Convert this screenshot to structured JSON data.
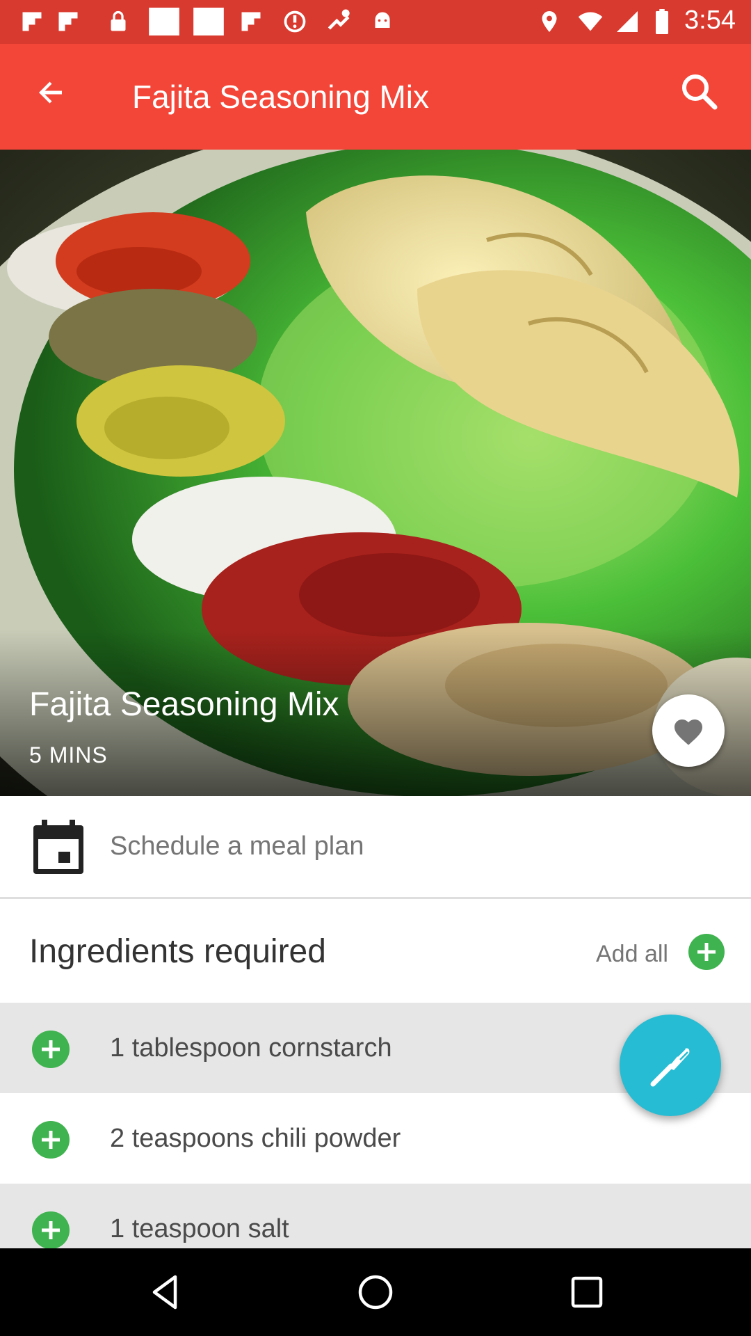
{
  "status_bar": {
    "time": "3:54",
    "icons": [
      "flipboard-icon",
      "flipboard-icon",
      "lock-icon",
      "blank-notification-icon",
      "blank-notification-icon",
      "flipboard-icon",
      "sync-icon",
      "fake-gps-icon",
      "android-icon",
      "location-icon",
      "wifi-icon",
      "signal-icon",
      "battery-icon"
    ]
  },
  "app_bar": {
    "title": "Fajita Seasoning Mix",
    "back_icon": "arrow-back-icon",
    "search_icon": "search-icon",
    "color": "#f44638"
  },
  "hero": {
    "title": "Fajita Seasoning Mix",
    "duration": "5 MINS",
    "favorite_icon": "heart-icon"
  },
  "schedule": {
    "label": "Schedule a meal plan",
    "icon": "calendar-icon"
  },
  "ingredients": {
    "title": "Ingredients required",
    "add_all_label": "Add all",
    "add_icon": "add-circle-icon",
    "accent_color": "#3fb34f",
    "items": [
      {
        "text": "1 tablespoon cornstarch"
      },
      {
        "text": "2 teaspoons chili powder"
      },
      {
        "text": "1 teaspoon salt"
      }
    ]
  },
  "fab": {
    "icon": "fork-icon",
    "color": "#26bcd3"
  },
  "nav_bar": {
    "icons": [
      "nav-back-icon",
      "nav-home-icon",
      "nav-recents-icon"
    ]
  }
}
